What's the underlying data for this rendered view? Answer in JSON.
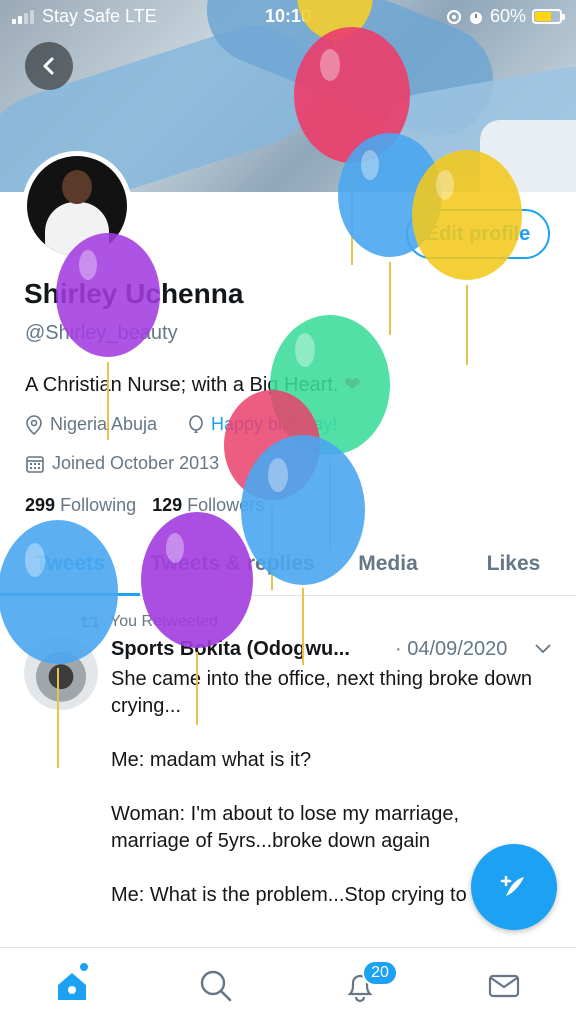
{
  "status_bar": {
    "carrier": "Stay Safe  LTE",
    "time": "10:10",
    "battery": "60%"
  },
  "profile": {
    "name": "Shirley Uchenna",
    "handle": "@Shirley_beauty",
    "bio": "A Christian Nurse; with a Big Heart.",
    "location": "Nigeria Abuja",
    "birthday": "Happy birthday!",
    "joined": "Joined October 2013",
    "following_count": "299",
    "following_label": "Following",
    "followers_count": "129",
    "followers_label": "Followers",
    "edit_button": "Edit profile"
  },
  "tabs": [
    "Tweets",
    "Tweets & replies",
    "Media",
    "Likes"
  ],
  "tweet": {
    "retweet_label": "You Retweeted",
    "author": "Sports Bokita (Odogwu...",
    "date": "· 04/09/2020",
    "text": "She came into the office, next thing broke down crying...\n\nMe: madam what is it?\n\nWoman: I'm about to lose my marriage, marriage of 5yrs...broke down again\n\nMe: What is the problem...Stop crying to me"
  },
  "bottom_nav": {
    "notification_badge": "20"
  },
  "icons": [
    "back-icon",
    "location-icon",
    "balloon-icon",
    "calendar-icon",
    "retweet-icon",
    "chevron-down-icon",
    "compose-icon",
    "home-icon",
    "search-icon",
    "bell-icon",
    "mail-icon"
  ],
  "colors": {
    "accent": "#1da1f2",
    "text": "#14171a",
    "muted": "#657786"
  }
}
